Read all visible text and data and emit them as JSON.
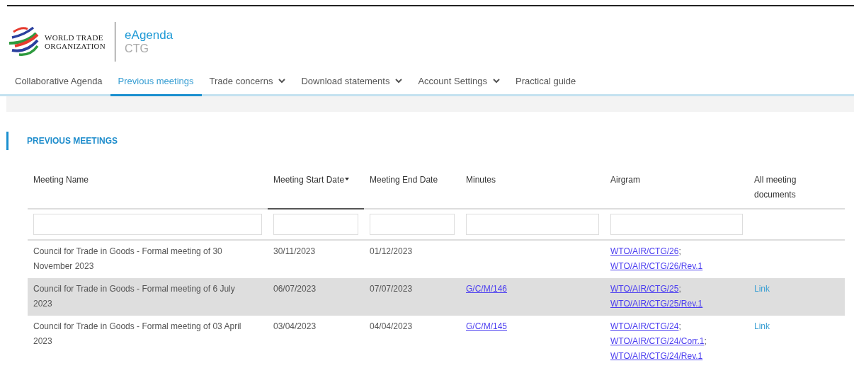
{
  "header": {
    "org_lines": [
      "WORLD TRADE",
      "ORGANIZATION"
    ],
    "app_name": "eAgenda",
    "app_sub": "CTG"
  },
  "nav": [
    {
      "label": "Collaborative Agenda",
      "selected": false,
      "dropdown": false
    },
    {
      "label": "Previous meetings",
      "selected": true,
      "dropdown": false
    },
    {
      "label": "Trade concerns",
      "selected": false,
      "dropdown": true
    },
    {
      "label": "Download statements",
      "selected": false,
      "dropdown": true
    },
    {
      "label": "Account Settings",
      "selected": false,
      "dropdown": true
    },
    {
      "label": "Practical guide",
      "selected": false,
      "dropdown": false
    }
  ],
  "section_title": "PREVIOUS MEETINGS",
  "table": {
    "columns": [
      {
        "label": "Meeting Name",
        "sorted": false,
        "filter": true
      },
      {
        "label": "Meeting Start Date",
        "sorted": true,
        "filter": true
      },
      {
        "label": "Meeting End Date",
        "sorted": false,
        "filter": true
      },
      {
        "label": "Minutes",
        "sorted": false,
        "filter": true
      },
      {
        "label": "Airgram",
        "sorted": false,
        "filter": true
      },
      {
        "label": "All meeting documents",
        "sorted": false,
        "filter": false
      }
    ],
    "rows": [
      {
        "highlighted": false,
        "name": "Council for Trade in Goods - Formal meeting of 30 November 2023",
        "start": "30/11/2023",
        "end": "01/12/2023",
        "airgram": [
          {
            "link": "WTO/AIR/CTG/26",
            "suffix": ";"
          },
          {
            "link": "WTO/AIR/CTG/26/Rev.1"
          }
        ]
      },
      {
        "highlighted": true,
        "name": "Council for Trade in Goods - Formal meeting of 6 July 2023",
        "start": "06/07/2023",
        "end": "07/07/2023",
        "minutes": "G/C/M/146",
        "airgram": [
          {
            "link": "WTO/AIR/CTG/25",
            "suffix": ";"
          },
          {
            "link": "WTO/AIR/CTG/25/Rev.1"
          }
        ],
        "documents": "Link"
      },
      {
        "highlighted": false,
        "name": "Council for Trade in Goods - Formal meeting of 03 April 2023",
        "start": "03/04/2023",
        "end": "04/04/2023",
        "minutes": "G/C/M/145",
        "airgram": [
          {
            "link": "WTO/AIR/CTG/24",
            "suffix": ";"
          },
          {
            "link": "WTO/AIR/CTG/24/Corr.1",
            "suffix": ";"
          },
          {
            "link": "WTO/AIR/CTG/24/Rev.1"
          }
        ],
        "documents": "Link"
      }
    ]
  }
}
